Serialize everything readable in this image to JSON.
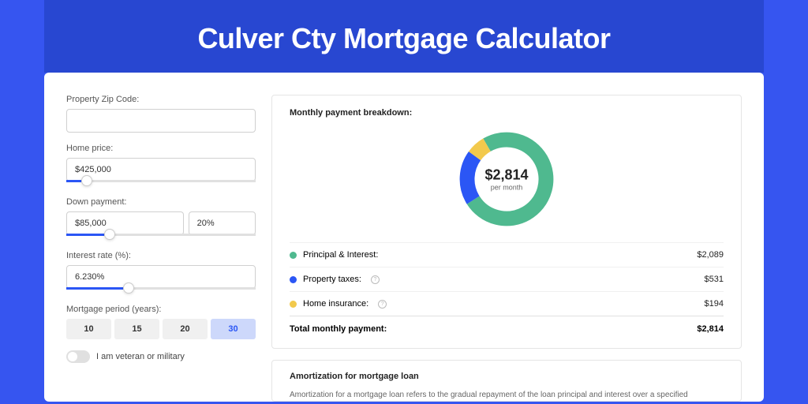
{
  "page_title": "Culver Cty Mortgage Calculator",
  "form": {
    "zip_label": "Property Zip Code:",
    "zip_value": "",
    "home_price_label": "Home price:",
    "home_price_value": "$425,000",
    "down_payment_label": "Down payment:",
    "down_payment_value": "$85,000",
    "down_payment_pct": "20%",
    "interest_rate_label": "Interest rate (%):",
    "interest_rate_value": "6.230%",
    "period_label": "Mortgage period (years):",
    "periods": [
      "10",
      "15",
      "20",
      "30"
    ],
    "period_active_index": 3,
    "veteran_label": "I am veteran or military"
  },
  "breakdown": {
    "title": "Monthly payment breakdown:",
    "chart_data": {
      "type": "donut",
      "center_amount": "$2,814",
      "center_sub": "per month",
      "slices": [
        {
          "name": "Principal & Interest",
          "value": 2089,
          "color": "#4fb98f"
        },
        {
          "name": "Property taxes",
          "value": 531,
          "color": "#2b56f5"
        },
        {
          "name": "Home insurance",
          "value": 194,
          "color": "#f2c94c"
        }
      ]
    },
    "rows": [
      {
        "label": "Principal & Interest:",
        "value": "$2,089",
        "color": "g",
        "info": false
      },
      {
        "label": "Property taxes:",
        "value": "$531",
        "color": "b",
        "info": true
      },
      {
        "label": "Home insurance:",
        "value": "$194",
        "color": "y",
        "info": true
      }
    ],
    "total_label": "Total monthly payment:",
    "total_value": "$2,814"
  },
  "amort": {
    "title": "Amortization for mortgage loan",
    "text": "Amortization for a mortgage loan refers to the gradual repayment of the loan principal and interest over a specified"
  }
}
